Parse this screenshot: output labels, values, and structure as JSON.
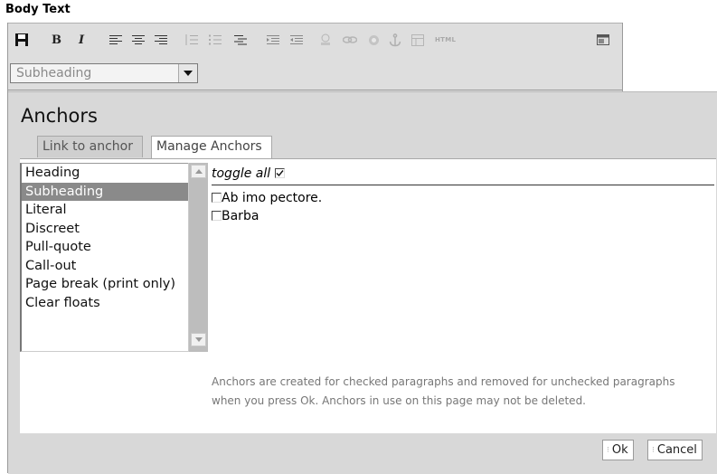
{
  "field_label": "Body Text",
  "toolbar": {
    "style_select_value": "Subheading",
    "buttons": [
      {
        "name": "save-icon"
      },
      {
        "name": "bold-icon",
        "glyph": "B"
      },
      {
        "name": "italic-icon",
        "glyph": "I"
      },
      {
        "name": "align-left-icon"
      },
      {
        "name": "align-center-icon"
      },
      {
        "name": "align-right-icon"
      },
      {
        "name": "ordered-list-icon"
      },
      {
        "name": "unordered-list-icon"
      },
      {
        "name": "definition-list-icon"
      },
      {
        "name": "outdent-icon"
      },
      {
        "name": "indent-icon"
      },
      {
        "name": "image-icon"
      },
      {
        "name": "link-icon"
      },
      {
        "name": "external-link-icon"
      },
      {
        "name": "anchor-icon"
      },
      {
        "name": "table-icon"
      },
      {
        "name": "html-icon",
        "glyph": "HTML"
      },
      {
        "name": "fullscreen-icon"
      }
    ]
  },
  "dialog": {
    "title": "Anchors",
    "tabs": [
      "Link to anchor",
      "Manage Anchors"
    ],
    "active_tab": "Manage Anchors",
    "style_list": [
      "Heading",
      "Subheading",
      "Literal",
      "Discreet",
      "Pull-quote",
      "Call-out",
      "Page break (print only)",
      "Clear floats"
    ],
    "selected_style": "Subheading",
    "toggle_all_label": "toggle all",
    "toggle_all_checked": true,
    "anchors": [
      {
        "label": "Ab imo pectore.",
        "checked": false
      },
      {
        "label": "Barba",
        "checked": false
      }
    ],
    "help_text": "Anchors are created for checked paragraphs and removed for unchecked paragraphs when you press Ok. Anchors in use on this page may not be deleted.",
    "ok_label": "Ok",
    "cancel_label": "Cancel"
  }
}
